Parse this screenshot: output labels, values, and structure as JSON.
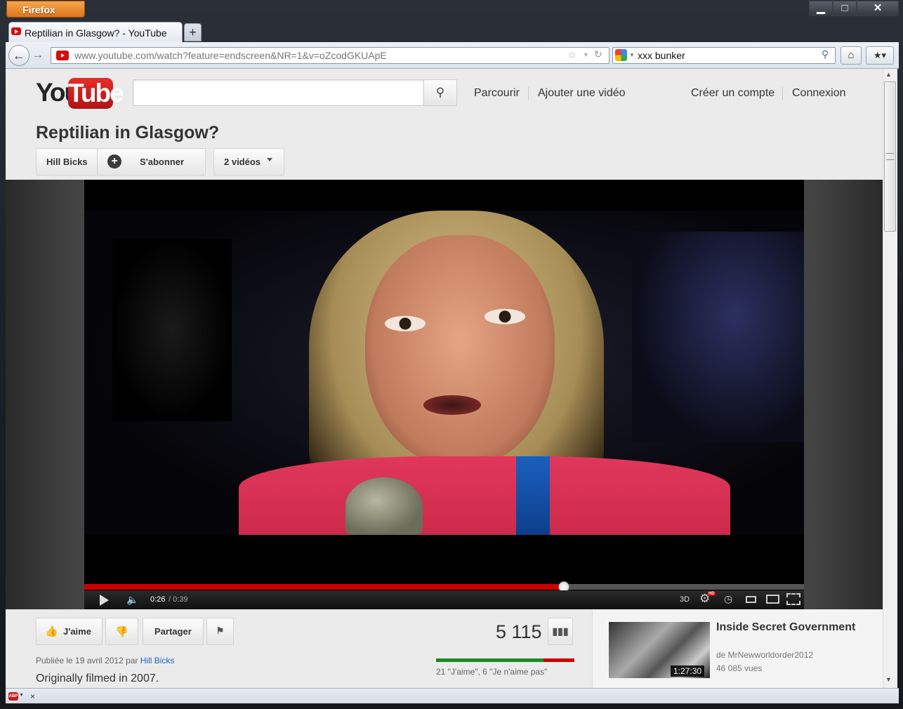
{
  "browser": {
    "app_button": "Firefox",
    "window_controls": {
      "minimize": "▁",
      "maximize": "□",
      "close": "✕"
    },
    "tabs": [
      {
        "title": "Reptilian in Glasgow? - YouTube",
        "active": true
      }
    ],
    "new_tab_label": "+",
    "nav": {
      "back": "←",
      "forward": "→",
      "home": "⌂",
      "bookmarks": "★▾"
    },
    "url": "www.youtube.com/watch?feature=endscreen&NR=1&v=oZcodGKUApE",
    "search_query": "xxx bunker",
    "status_addon": "ABP",
    "status_close": "×"
  },
  "youtube": {
    "logo": {
      "you": "You",
      "tube": "Tube"
    },
    "search_placeholder": "",
    "search_icon": "search-icon",
    "header_links": {
      "browse": "Parcourir",
      "upload": "Ajouter une vidéo",
      "create_account": "Créer un compte",
      "sign_in": "Connexion"
    },
    "video": {
      "title": "Reptilian in Glasgow?",
      "channel": "Hill Bicks",
      "subscribe": "S'abonner",
      "videos_count": "2 vidéos",
      "player": {
        "current_time": "0:26",
        "total_time": " / 0:39",
        "progress": 0.6667,
        "three_d": "3D",
        "hd": "HD"
      },
      "like": "J'aime",
      "share": "Partager",
      "views": "5 115",
      "likes": 21,
      "dislikes": 6,
      "ratio_text": "21 \"J'aime\", 6 \"Je n'aime pas\"",
      "published_prefix": "Publiée le 19 avril 2012 par ",
      "published_author": "Hill Bicks",
      "description": "Originally filmed in 2007."
    },
    "related": [
      {
        "title": "Inside Secret Government",
        "channel": "de MrNewworldorder2012",
        "views": "46 085 vues",
        "duration": "1:27:30"
      }
    ]
  },
  "colors": {
    "yt_red": "#cc0000",
    "like_green": "#1a8a22",
    "link_blue": "#1b65c2"
  }
}
